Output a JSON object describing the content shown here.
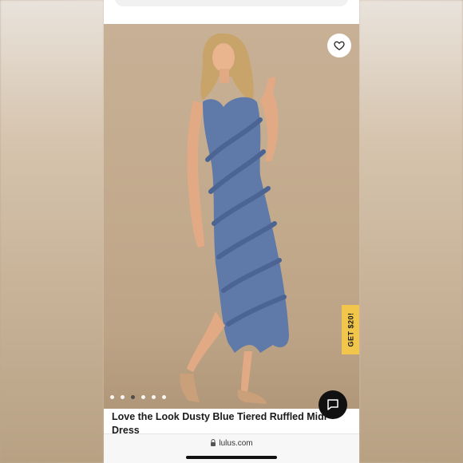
{
  "product": {
    "title": "Love the Look Dusty Blue Tiered Ruffled Midi Dress",
    "image_dots": [
      false,
      false,
      true,
      false,
      false,
      false
    ]
  },
  "promo": {
    "label": "GET $20!"
  },
  "browser": {
    "url": "lulus.com"
  },
  "icons": {
    "favorite": "heart-icon",
    "chat": "chat-icon",
    "lock": "lock-icon"
  },
  "colors": {
    "promo_bg": "#f1c64a",
    "chat_bg": "#111111",
    "dress": "#5f79a8"
  }
}
